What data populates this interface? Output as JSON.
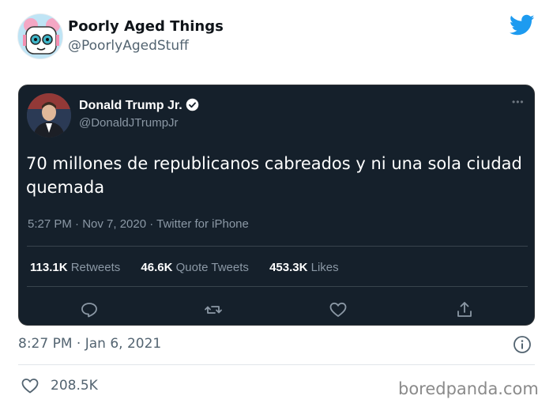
{
  "account": {
    "name": "Poorly Aged Things",
    "handle": "@PoorlyAgedStuff"
  },
  "embedded_tweet": {
    "name": "Donald Trump Jr.",
    "handle": "@DonaldJTrumpJr",
    "more": "•••",
    "text": "70 millones de republicanos cabreados y ni una sola ciudad quemada",
    "time": "5:27 PM · Nov 7, 2020 · Twitter for iPhone",
    "stats": [
      {
        "value": "113.1K",
        "label": "Retweets"
      },
      {
        "value": "46.6K",
        "label": "Quote Tweets"
      },
      {
        "value": "453.3K",
        "label": "Likes"
      }
    ],
    "actions": [
      "reply-icon",
      "retweet-icon",
      "like-icon",
      "share-icon"
    ]
  },
  "footer": {
    "time": "8:27 PM · Jan 6, 2021",
    "likes": "208.5K",
    "watermark": "boredpanda.com"
  },
  "colors": {
    "twitter_blue": "#1d9bf0",
    "embedded_bg": "#15202b",
    "muted_text": "#536471"
  }
}
